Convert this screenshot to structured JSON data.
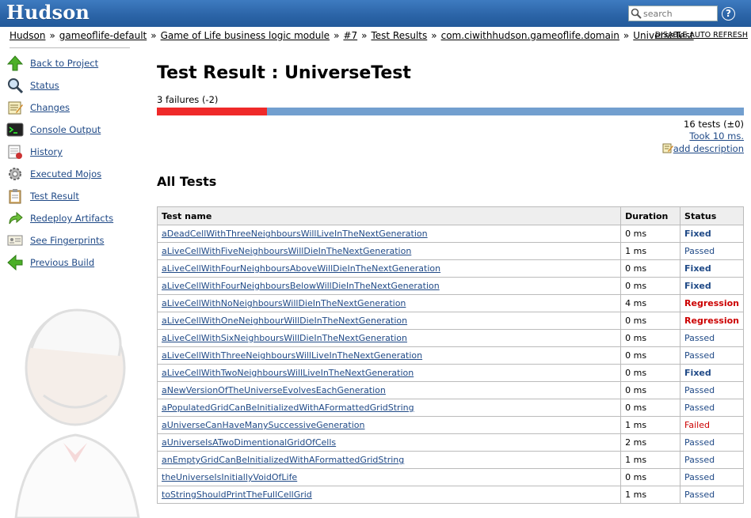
{
  "header": {
    "logo": "Hudson",
    "search_placeholder": "search",
    "help": "?"
  },
  "breadcrumb": [
    "Hudson",
    "gameoflife-default",
    "Game of Life business logic module",
    "#7",
    "Test Results",
    "com.ciwithhudson.gameoflife.domain",
    "UniverseTest"
  ],
  "breadcrumb_sep": "»",
  "auto_refresh": "DISABLE AUTO REFRESH",
  "sidebar": {
    "tasks": [
      {
        "label": "Back to Project",
        "icon": "up-arrow-icon"
      },
      {
        "label": "Status",
        "icon": "magnifier-icon"
      },
      {
        "label": "Changes",
        "icon": "notepad-icon"
      },
      {
        "label": "Console Output",
        "icon": "terminal-icon"
      },
      {
        "label": "History",
        "icon": "history-icon"
      },
      {
        "label": "Executed Mojos",
        "icon": "gear-icon"
      },
      {
        "label": "Test Result",
        "icon": "clipboard-icon"
      },
      {
        "label": "Redeploy Artifacts",
        "icon": "redeploy-arrow-icon"
      },
      {
        "label": "See Fingerprints",
        "icon": "fingerprint-card-icon"
      },
      {
        "label": "Previous Build",
        "icon": "left-arrow-icon"
      }
    ]
  },
  "main": {
    "title": "Test Result : UniverseTest",
    "fail_summary": "3 failures (-2)",
    "fail_fraction": 0.1875,
    "tests_count": "16 tests (±0)",
    "took": "Took 10 ms.",
    "add_description": "add description",
    "all_tests": "All Tests"
  },
  "colors": {
    "fail": "#EF2929",
    "pass": "#729FCF",
    "link": "#204A87",
    "header": "#2a63a6"
  },
  "table": {
    "headers": [
      "Test name",
      "Duration",
      "Status"
    ],
    "rows": [
      {
        "name": "aDeadCellWithThreeNeighboursWillLiveInTheNextGeneration",
        "duration": "0 ms",
        "status": "Fixed"
      },
      {
        "name": "aLiveCellWithFiveNeighboursWillDieInTheNextGeneration",
        "duration": "1 ms",
        "status": "Passed"
      },
      {
        "name": "aLiveCellWithFourNeighboursAboveWillDieInTheNextGeneration",
        "duration": "0 ms",
        "status": "Fixed"
      },
      {
        "name": "aLiveCellWithFourNeighboursBelowWillDieInTheNextGeneration",
        "duration": "0 ms",
        "status": "Fixed"
      },
      {
        "name": "aLiveCellWithNoNeighboursWillDieInTheNextGeneration",
        "duration": "4 ms",
        "status": "Regression"
      },
      {
        "name": "aLiveCellWithOneNeighbourWillDieInTheNextGeneration",
        "duration": "0 ms",
        "status": "Regression"
      },
      {
        "name": "aLiveCellWithSixNeighboursWillDieInTheNextGeneration",
        "duration": "0 ms",
        "status": "Passed"
      },
      {
        "name": "aLiveCellWithThreeNeighboursWillLiveInTheNextGeneration",
        "duration": "0 ms",
        "status": "Passed"
      },
      {
        "name": "aLiveCellWithTwoNeighboursWillLiveInTheNextGeneration",
        "duration": "0 ms",
        "status": "Fixed"
      },
      {
        "name": "aNewVersionOfTheUniverseEvolvesEachGeneration",
        "duration": "0 ms",
        "status": "Passed"
      },
      {
        "name": "aPopulatedGridCanBeInitializedWithAFormattedGridString",
        "duration": "0 ms",
        "status": "Passed"
      },
      {
        "name": "aUniverseCanHaveManySuccessiveGeneration",
        "duration": "1 ms",
        "status": "Failed"
      },
      {
        "name": "aUniverseIsATwoDimentionalGridOfCells",
        "duration": "2 ms",
        "status": "Passed"
      },
      {
        "name": "anEmptyGridCanBeInitializedWithAFormattedGridString",
        "duration": "1 ms",
        "status": "Passed"
      },
      {
        "name": "theUniverseIsInitiallyVoidOfLife",
        "duration": "0 ms",
        "status": "Passed"
      },
      {
        "name": "toStringShouldPrintTheFullCellGrid",
        "duration": "1 ms",
        "status": "Passed"
      }
    ]
  }
}
